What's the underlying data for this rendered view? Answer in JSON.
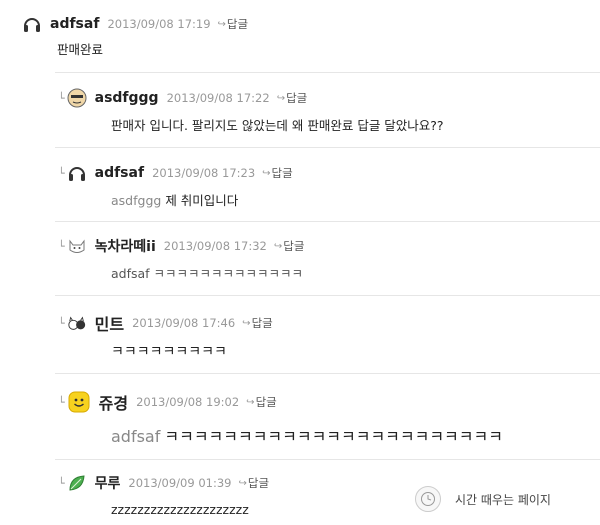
{
  "reply_label": "답글",
  "comments": [
    {
      "author": "adfsaf",
      "date": "2013/09/08 17:19",
      "mention": "",
      "text": "판매완료",
      "avatar_icon": "headphones-icon"
    },
    {
      "author": "asdfggg",
      "date": "2013/09/08 17:22",
      "mention": "",
      "text": "판매자 입니다. 팔리지도 않았는데 왜 판매완료 답글 달았나요??",
      "avatar_icon": "face-avatar-icon"
    },
    {
      "author": "adfsaf",
      "date": "2013/09/08 17:23",
      "mention": "asdfggg",
      "text": "제 취미입니다",
      "avatar_icon": "headphones-icon"
    },
    {
      "author": "녹차라떼ii",
      "date": "2013/09/08 17:32",
      "mention": "",
      "text": "adfsaf ㅋㅋㅋㅋㅋㅋㅋㅋㅋㅋㅋㅋㅋ",
      "avatar_icon": "cat-avatar-icon"
    },
    {
      "author": "민트",
      "date": "2013/09/08 17:46",
      "mention": "",
      "text": "ㅋㅋㅋㅋㅋㅋㅋㅋㅋ",
      "avatar_icon": "cats-avatar-icon"
    },
    {
      "author": "쥬경",
      "date": "2013/09/08 19:02",
      "mention": "adfsaf",
      "text": "ㅋㅋㅋㅋㅋㅋㅋㅋㅋㅋㅋㅋㅋㅋㅋㅋㅋㅋㅋㅋㅋㅋㅋ",
      "avatar_icon": "smiley-avatar-icon"
    },
    {
      "author": "무루",
      "date": "2013/09/09 01:39",
      "mention": "",
      "text": "zzzzzzzzzzzzzzzzzzzzz",
      "avatar_icon": "leaf-avatar-icon"
    }
  ],
  "widget": {
    "text": "시간 때우는 페이지",
    "icon": "clock-icon"
  }
}
